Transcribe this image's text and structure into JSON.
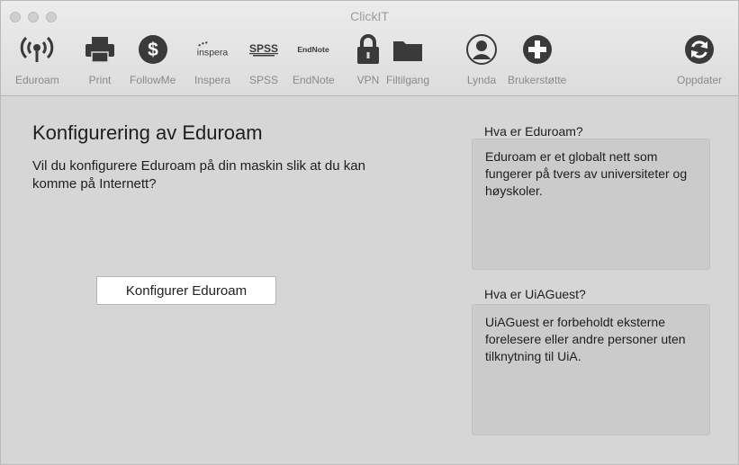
{
  "window": {
    "title": "ClickIT"
  },
  "toolbar": {
    "items": [
      {
        "label": "Eduroam",
        "icon": "wifi-broadcast-icon"
      },
      {
        "label": "Print",
        "icon": "printer-icon"
      },
      {
        "label": "FollowMe",
        "icon": "dollar-circle-icon"
      },
      {
        "label": "Inspera",
        "icon": "inspera-logo-icon",
        "logo_text": "inspera"
      },
      {
        "label": "SPSS",
        "icon": "spss-logo-icon",
        "logo_text": "SPSS"
      },
      {
        "label": "EndNote",
        "icon": "endnote-logo-icon",
        "logo_text": "EndNote"
      },
      {
        "label": "VPN",
        "icon": "lock-icon"
      },
      {
        "label": "Filtilgang",
        "icon": "folder-icon"
      },
      {
        "label": "Lynda",
        "icon": "lynda-avatar-icon"
      },
      {
        "label": "Brukerstøtte",
        "icon": "plus-circle-icon"
      },
      {
        "label": "Oppdater",
        "icon": "refresh-icon"
      }
    ]
  },
  "main": {
    "title": "Konfigurering av Eduroam",
    "description": "Vil du konfigurere Eduroam på din maskin slik at du kan komme på Internett?",
    "button_label": "Konfigurer Eduroam"
  },
  "sidebar": {
    "eduroam_heading": "Hva er Eduroam?",
    "eduroam_text": "Eduroam er et globalt nett som fungerer på tvers av universiteter og høyskoler.",
    "uiaguest_heading": "Hva er UiAGuest?",
    "uiaguest_text": "UiAGuest er forbeholdt eksterne forelesere eller andre personer uten tilknytning til UiA."
  },
  "colors": {
    "icon_dark": "#3a3a3a",
    "background": "#d6d6d6",
    "info_box": "#cbcbcb"
  }
}
